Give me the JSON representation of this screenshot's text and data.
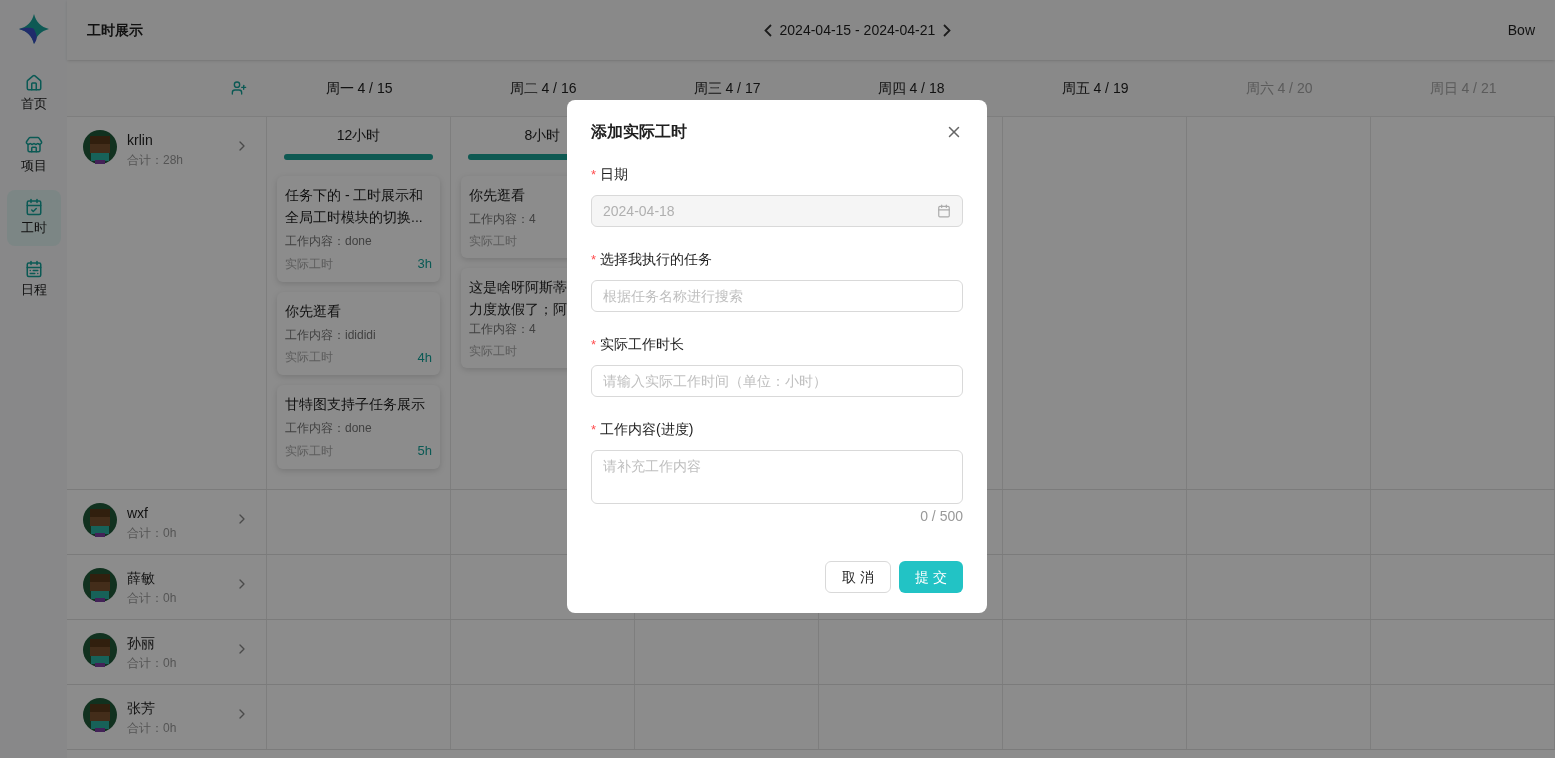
{
  "sidebar": {
    "items": [
      {
        "label": "首页",
        "selected": false
      },
      {
        "label": "项目",
        "selected": false
      },
      {
        "label": "工时",
        "selected": true
      },
      {
        "label": "日程",
        "selected": false
      }
    ]
  },
  "header": {
    "title": "工时展示",
    "range": "2024-04-15 - 2024-04-21",
    "user": "Bow"
  },
  "days": [
    {
      "label": "周一 4 / 15",
      "disabled": false
    },
    {
      "label": "周二 4 / 16",
      "disabled": false
    },
    {
      "label": "周三 4 / 17",
      "disabled": false
    },
    {
      "label": "周四 4 / 18",
      "disabled": false
    },
    {
      "label": "周五 4 / 19",
      "disabled": false
    },
    {
      "label": "周六 4 / 20",
      "disabled": true
    },
    {
      "label": "周日 4 / 21",
      "disabled": true
    }
  ],
  "people": [
    {
      "name": "krlin",
      "total": "合计：28h",
      "days": [
        {
          "total": "12小时",
          "level": 1,
          "cards": [
            {
              "title": "任务下的 - 工时展示和全局工时模块的切换...",
              "content": "工作内容：done",
              "hours_label": "实际工时",
              "hours": "3h"
            },
            {
              "title": "你先逛看",
              "content": "工作内容：idididi",
              "hours_label": "实际工时",
              "hours": "4h"
            },
            {
              "title": "甘特图支持子任务展示",
              "content": "工作内容：done",
              "hours_label": "实际工时",
              "hours": "5h"
            }
          ]
        },
        {
          "total": "8小时",
          "level": 1,
          "cards": [
            {
              "title": "你先逛看",
              "content": "工作内容：4",
              "hours_label": "实际工时"
            },
            {
              "title_lines": [
                "这是啥呀阿斯蒂",
                "力度放假了；阿"
              ],
              "content": "工作内容：4",
              "hours_label": "实际工时"
            }
          ]
        }
      ]
    },
    {
      "name": "wxf",
      "total": "合计：0h"
    },
    {
      "name": "薛敏",
      "total": "合计：0h"
    },
    {
      "name": "孙丽",
      "total": "合计：0h"
    },
    {
      "name": "张芳",
      "total": "合计：0h"
    }
  ],
  "dialog": {
    "title": "添加实际工时",
    "fields": [
      {
        "kind": "date",
        "label": "日期",
        "required_mark": "*",
        "value": "2024-04-18",
        "disabled": true
      },
      {
        "kind": "input",
        "label": "选择我执行的任务",
        "required_mark": "*",
        "placeholder": "根据任务名称进行搜索"
      },
      {
        "kind": "input",
        "label": "实际工作时长",
        "required_mark": "*",
        "placeholder": "请输入实际工作时间（单位：小时）"
      },
      {
        "kind": "textarea",
        "label": "工作内容(进度)",
        "required_mark": "*",
        "placeholder": "请补充工作内容",
        "counter": "0 / 500"
      }
    ],
    "buttons": [
      {
        "label": "取 消",
        "kind": "default"
      },
      {
        "label": "提 交",
        "kind": "primary"
      }
    ]
  }
}
